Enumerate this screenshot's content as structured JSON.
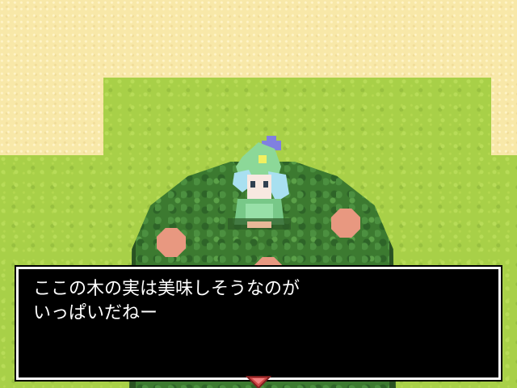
{
  "scene": {
    "colors": {
      "grass": "#a8d048",
      "sand": "#f8e8a8",
      "bush": "#3c7a30",
      "fruit": "#e89880",
      "window_bg": "#000000",
      "window_border": "#ffffff",
      "text": "#ffffff"
    },
    "icons": {
      "character": "green-hooded-girl-sprite",
      "fruit": "peach-fruit-icon",
      "advance": "triangle-down-icon"
    }
  },
  "message": {
    "lines": [
      "ここの木の実は美味しそうなのが",
      "いっぱいだねー"
    ]
  }
}
